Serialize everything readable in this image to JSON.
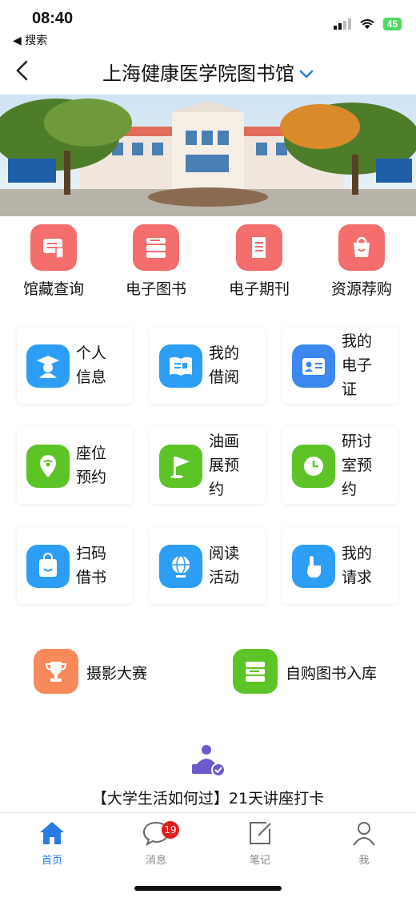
{
  "status": {
    "time": "08:40",
    "back_app": "◀ 搜索",
    "battery": "45"
  },
  "nav": {
    "title": "上海健康医学院图书馆"
  },
  "quick": [
    {
      "label": "馆藏查询",
      "icon": "catalog-search-icon"
    },
    {
      "label": "电子图书",
      "icon": "ebook-icon"
    },
    {
      "label": "电子期刊",
      "icon": "ejournal-icon"
    },
    {
      "label": "资源荐购",
      "icon": "shopping-bag-icon"
    }
  ],
  "cards": [
    {
      "label": "个人信息",
      "l1": "个人",
      "l2": "信息",
      "l3": ""
    },
    {
      "label": "我的借阅",
      "l1": "我的",
      "l2": "借阅",
      "l3": ""
    },
    {
      "label": "我的电子证",
      "l1": "我的",
      "l2": "电子",
      "l3": "证"
    },
    {
      "label": "座位预约",
      "l1": "座位",
      "l2": "预约",
      "l3": ""
    },
    {
      "label": "油画展预约",
      "l1": "油画",
      "l2": "展预",
      "l3": "约"
    },
    {
      "label": "研讨室预约",
      "l1": "研讨",
      "l2": "室预",
      "l3": "约"
    },
    {
      "label": "扫码借书",
      "l1": "扫码",
      "l2": "借书",
      "l3": ""
    },
    {
      "label": "阅读活动",
      "l1": "阅读",
      "l2": "活动",
      "l3": ""
    },
    {
      "label": "我的请求",
      "l1": "我的",
      "l2": "请求",
      "l3": ""
    }
  ],
  "wide": [
    {
      "label": "摄影大赛"
    },
    {
      "label": "自购图书入库"
    }
  ],
  "promo": {
    "text": "【大学生活如何过】21天讲座打卡"
  },
  "tabs": [
    {
      "label": "首页"
    },
    {
      "label": "消息",
      "badge": "19"
    },
    {
      "label": "笔记"
    },
    {
      "label": "我"
    }
  ],
  "colors": {
    "accent": "#2a7be4",
    "quick_icon_bg": "#f46e6e",
    "blue_icon": "#2d9ef5",
    "green_icon": "#5cc427",
    "badge": "#e21b1b"
  }
}
